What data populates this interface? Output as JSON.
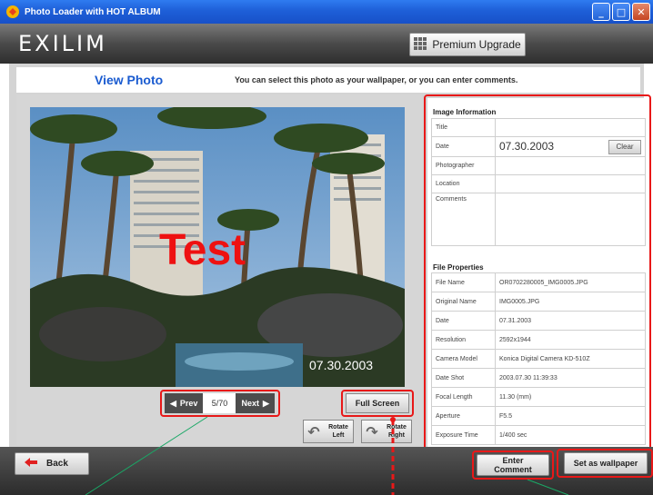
{
  "window": {
    "title": "Photo Loader with HOT ALBUM",
    "controls": [
      "_",
      "□",
      "✕"
    ]
  },
  "header": {
    "logo": "EXILIM",
    "premium_label": "Premium Upgrade"
  },
  "view": {
    "title": "View Photo",
    "subtitle": "You can select this photo as your wallpaper, or you can enter comments."
  },
  "photo": {
    "overlay_text": "Test",
    "date_stamp": "07.30.2003"
  },
  "navigation": {
    "prev_label": "Prev",
    "counter": "5/70",
    "next_label": "Next"
  },
  "buttons": {
    "full_screen": "Full Screen",
    "rotate_left": [
      "Rotate",
      "Left"
    ],
    "rotate_right": [
      "Rotate",
      "Right"
    ],
    "back": "Back",
    "enter_comment": [
      "Enter",
      "Comment"
    ],
    "set_wallpaper": "Set as wallpaper"
  },
  "image_information": {
    "title": "Image Information",
    "rows": [
      {
        "label": "Title",
        "value": ""
      },
      {
        "label": "Date",
        "value": "07.30.2003",
        "button": "Clear"
      },
      {
        "label": "Photographer",
        "value": ""
      },
      {
        "label": "Location",
        "value": ""
      },
      {
        "label": "Comments",
        "value": ""
      }
    ]
  },
  "file_properties": {
    "title": "File Properties",
    "rows": [
      {
        "label": "File Name",
        "value": "OR0702280005_IMG0005.JPG"
      },
      {
        "label": "Original Name",
        "value": "IMG0005.JPG"
      },
      {
        "label": "Date",
        "value": "07.31.2003"
      },
      {
        "label": "Resolution",
        "value": "2592x1944"
      },
      {
        "label": "Camera Model",
        "value": "Konica Digital Camera KD-510Z"
      },
      {
        "label": "Date Shot",
        "value": "2003.07.30 11:39:33"
      },
      {
        "label": "Focal Length",
        "value": "11.30 (mm)"
      },
      {
        "label": "Aperture",
        "value": "F5.5"
      },
      {
        "label": "Exposure Time",
        "value": "1/400 sec"
      }
    ]
  },
  "colors": {
    "highlight": "#e81818",
    "title_blue": "#1a5bd0",
    "titlebar": "#1e5fd8"
  }
}
